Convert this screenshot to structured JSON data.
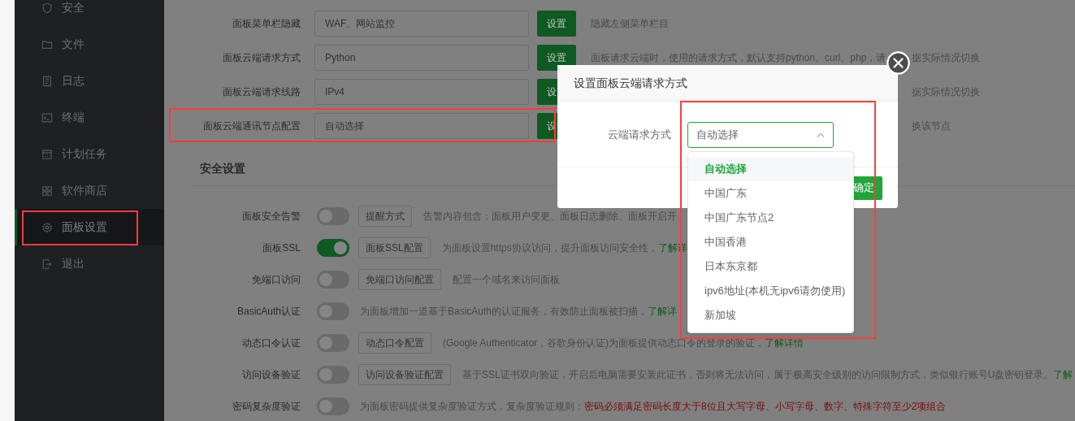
{
  "sidebar": {
    "items": [
      {
        "label": "安全",
        "selected": false
      },
      {
        "label": "文件",
        "selected": false
      },
      {
        "label": "日志",
        "selected": false
      },
      {
        "label": "终端",
        "selected": false
      },
      {
        "label": "计划任务",
        "selected": false
      },
      {
        "label": "软件商店",
        "selected": false
      },
      {
        "label": "面板设置",
        "selected": true
      },
      {
        "label": "退出",
        "selected": false
      }
    ]
  },
  "panel_rows": [
    {
      "label": "面板菜单栏隐藏",
      "value": "WAF、网站监控",
      "button": "设置",
      "description": "隐藏左侧菜单栏目"
    },
    {
      "label": "面板云端请求方式",
      "value": "Python",
      "button": "设置",
      "description": "面板请求云端时，使用的请求方式，默认支持python、curl、php，请",
      "description_tail": "据实际情况切换"
    },
    {
      "label": "面板云端请求线路",
      "value": "IPv4",
      "button": "设",
      "description_tail": "据实际情况切换"
    },
    {
      "label": "面板云端通讯节点配置",
      "value": "自动选择",
      "button": "设",
      "description_tail": "换该节点"
    }
  ],
  "security": {
    "title": "安全设置",
    "rows": [
      {
        "label": "面板安全告警",
        "on": false,
        "button": "提醒方式",
        "description": "告警内容包含：面板用户变更、面板日志删除、面板开启开"
      },
      {
        "label": "面板SSL",
        "on": true,
        "button": "面板SSL配置",
        "description": "为面板设置https协议访问，提升面板访问安全性，",
        "link": "了解详"
      },
      {
        "label": "免端口访问",
        "on": false,
        "button": "免端口访问配置",
        "description": "配置一个域名来访问面板"
      },
      {
        "label": "BasicAuth认证",
        "on": false,
        "description": "为面板增加一道基于BasicAuth的认证服务，有效防止面板被扫描，",
        "link": "了解详"
      },
      {
        "label": "动态口令认证",
        "on": false,
        "button": "动态口令配置",
        "description": "(Google Authenticator，谷歌身份认证)为面板提供动态口令的登录的验证，",
        "link": "了解详情"
      },
      {
        "label": "访问设备验证",
        "on": false,
        "button": "访问设备验证配置",
        "description": "基于SSL证书双向验证，开启后电脑需要安装此证书，否则将无法访问，属于极高安全级别的访问限制方式，类似银行账号U盘密钥登录。",
        "link": "了解"
      },
      {
        "label": "密码复杂度验证",
        "on": false,
        "description": "为面板密码提供复杂度验证方式，复杂度验证规则：",
        "warning": "密码必须满足密码长度大于8位且大写字母、小写字母、数字、特殊字符至少2项组合"
      }
    ]
  },
  "dialog": {
    "title": "设置面板云端请求方式",
    "field_label": "云端请求方式",
    "select_value": "自动选择",
    "expanded": true,
    "options": [
      {
        "label": "自动选择",
        "selected": true
      },
      {
        "label": "中国广东",
        "selected": false
      },
      {
        "label": "中国广东节点2",
        "selected": false
      },
      {
        "label": "中国香港",
        "selected": false
      },
      {
        "label": "日本东京都",
        "selected": false
      },
      {
        "label": "ipv6地址(本机无ipv6请勿使用)",
        "selected": false
      },
      {
        "label": "新加坡",
        "selected": false
      }
    ],
    "confirm": "确定"
  }
}
